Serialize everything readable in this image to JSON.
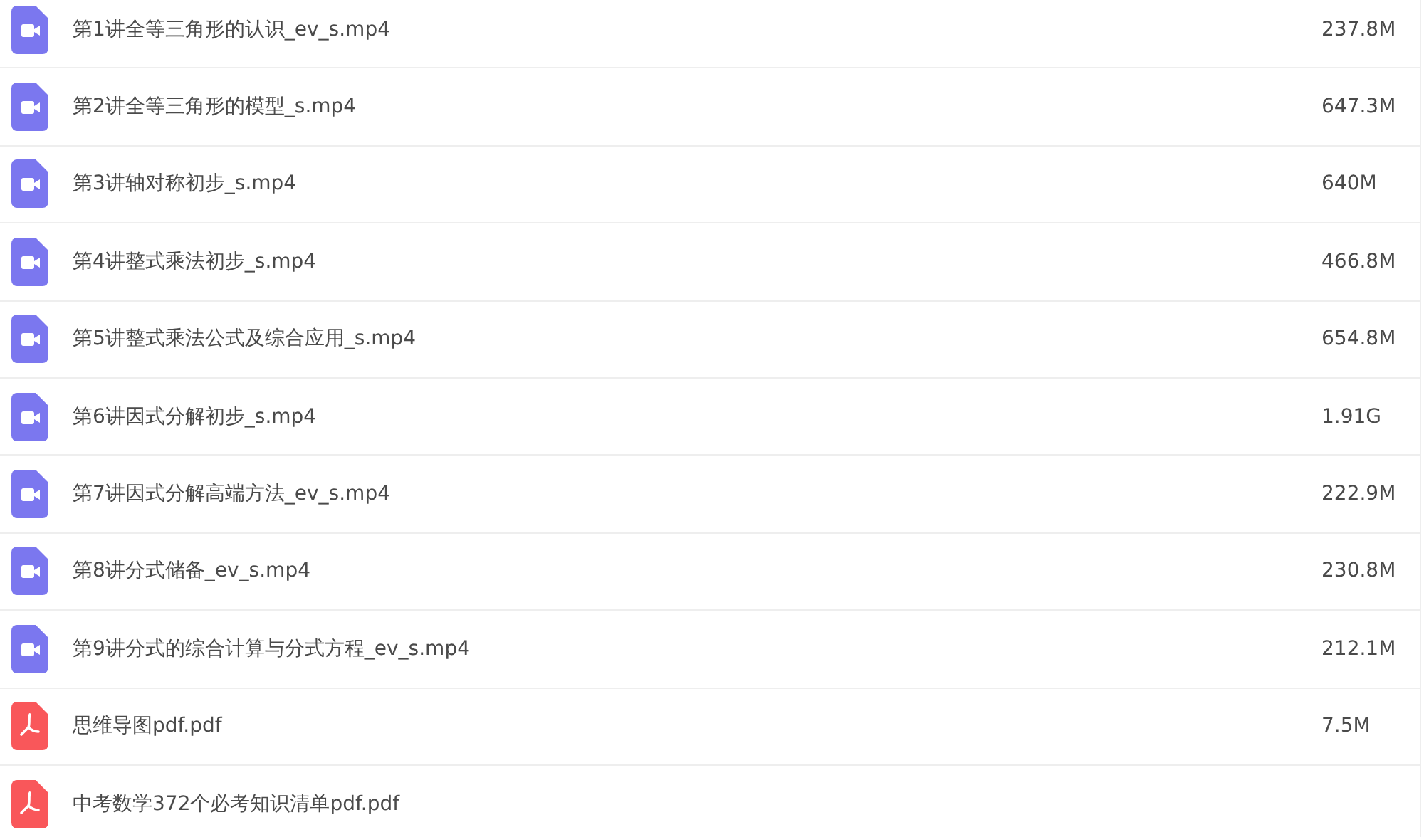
{
  "files": [
    {
      "kind": "video",
      "name": "第1讲全等三角形的认识_ev_s.mp4",
      "size": "237.8M"
    },
    {
      "kind": "video",
      "name": "第2讲全等三角形的模型_s.mp4",
      "size": "647.3M"
    },
    {
      "kind": "video",
      "name": "第3讲轴对称初步_s.mp4",
      "size": "640M"
    },
    {
      "kind": "video",
      "name": "第4讲整式乘法初步_s.mp4",
      "size": "466.8M"
    },
    {
      "kind": "video",
      "name": "第5讲整式乘法公式及综合应用_s.mp4",
      "size": "654.8M"
    },
    {
      "kind": "video",
      "name": "第6讲因式分解初步_s.mp4",
      "size": "1.91G"
    },
    {
      "kind": "video",
      "name": "第7讲因式分解高端方法_ev_s.mp4",
      "size": "222.9M"
    },
    {
      "kind": "video",
      "name": "第8讲分式储备_ev_s.mp4",
      "size": "230.8M"
    },
    {
      "kind": "video",
      "name": "第9讲分式的综合计算与分式方程_ev_s.mp4",
      "size": "212.1M"
    },
    {
      "kind": "pdf",
      "name": "思维导图pdf.pdf",
      "size": "7.5M"
    },
    {
      "kind": "pdf",
      "name": "中考数学372个必考知识清单pdf.pdf"
    }
  ]
}
